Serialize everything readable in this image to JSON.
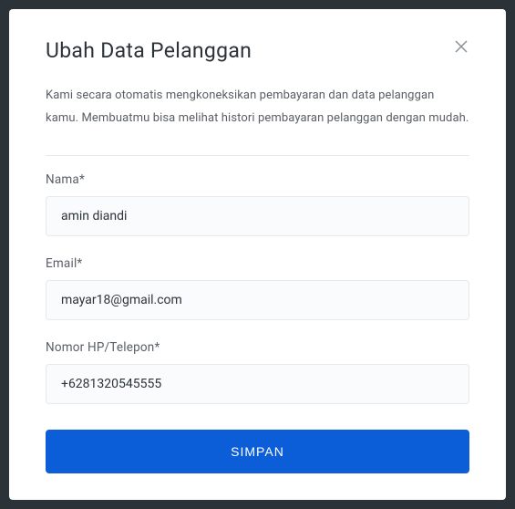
{
  "modal": {
    "title": "Ubah Data Pelanggan",
    "description": "Kami secara otomatis mengkoneksikan pembayaran dan data pelanggan kamu. Membuatmu bisa melihat histori pembayaran pelanggan dengan mudah.",
    "fields": {
      "name": {
        "label": "Nama*",
        "value": "amin diandi"
      },
      "email": {
        "label": "Email*",
        "value": "mayar18@gmail.com"
      },
      "phone": {
        "label": "Nomor HP/Telepon*",
        "value": "+6281320545555"
      }
    },
    "submit_label": "SIMPAN"
  }
}
